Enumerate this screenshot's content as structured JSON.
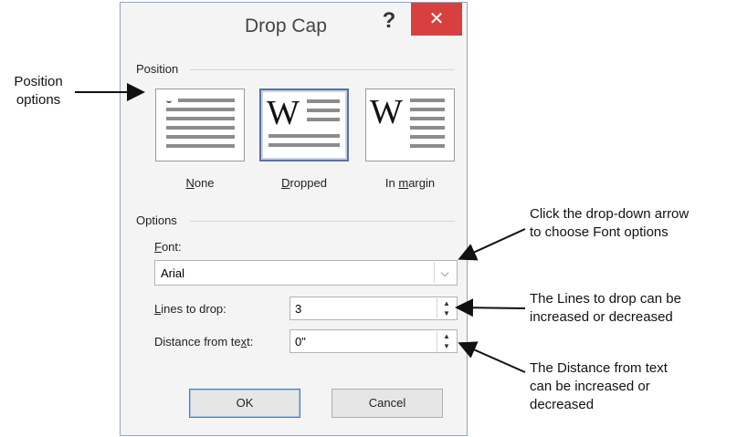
{
  "dialog": {
    "title": "Drop Cap",
    "help_label": "?",
    "close_label": "✕",
    "position_section": "Position",
    "positions": [
      {
        "label_pre": "",
        "label_u": "N",
        "label_post": "one",
        "selected": false
      },
      {
        "label_pre": "",
        "label_u": "D",
        "label_post": "ropped",
        "selected": true
      },
      {
        "label_pre": "In ",
        "label_u": "m",
        "label_post": "argin",
        "selected": false
      }
    ],
    "drop_letter": "W",
    "options_section": "Options",
    "font_label_u": "F",
    "font_label_rest": "ont:",
    "font_value": "Arial",
    "lines_label_u": "L",
    "lines_label_rest": "ines to drop:",
    "lines_value": "3",
    "distance_label_pre": "Distance from te",
    "distance_label_u": "x",
    "distance_label_post": "t:",
    "distance_value": "0\"",
    "ok_label": "OK",
    "cancel_label": "Cancel"
  },
  "annotations": {
    "position": [
      "Position",
      "options"
    ],
    "font": [
      "Click the drop-down arrow",
      "to choose Font options"
    ],
    "lines": [
      "The Lines to drop can be",
      "increased or decreased"
    ],
    "distance": [
      "The Distance from text",
      "can be increased or",
      "decreased"
    ]
  },
  "colors": {
    "close_button": "#d84040",
    "selected_border": "#5a6fa6"
  }
}
